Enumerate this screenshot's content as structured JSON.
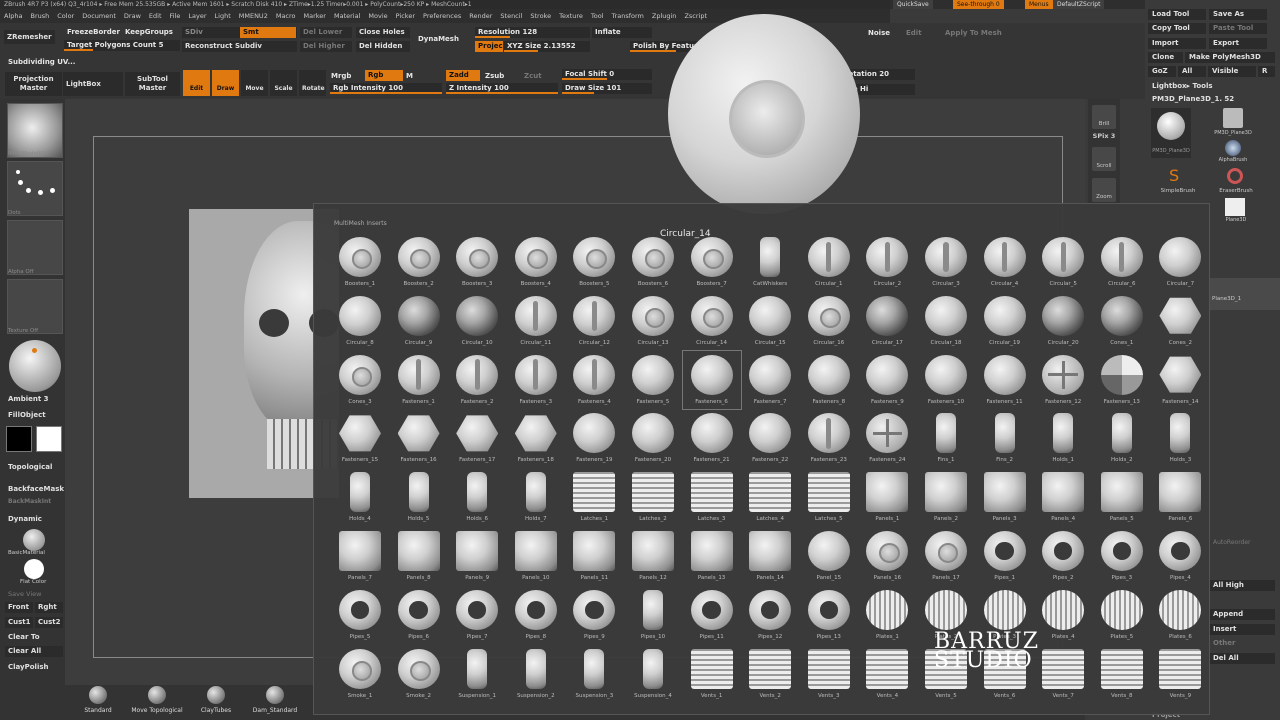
{
  "title_bar": {
    "text": "ZBrush 4R7 P3 (x64)   Q3_4r104   ▸ Free Mem 25.535GB ▸ Active Mem 1601 ▸ Scratch Disk 410 ▸ ZTime▸1.25 Timer▸0.001 ▸ PolyCount▸250 KP ▸ MeshCount▸1"
  },
  "top_right": {
    "quicksave": "QuickSave",
    "seethrough": "See-through 0",
    "menus": "Menus",
    "defaultzscript": "DefaultZScript"
  },
  "menus": [
    "Alpha",
    "Brush",
    "Color",
    "Document",
    "Draw",
    "Edit",
    "File",
    "Layer",
    "Light",
    "MMENU2",
    "Macro",
    "Marker",
    "Material",
    "Movie",
    "Picker",
    "Preferences",
    "Render",
    "Stencil",
    "Stroke",
    "Texture",
    "Tool",
    "Transform",
    "Zplugin",
    "Zscript"
  ],
  "toolbar": {
    "zremesher": "ZRemesher",
    "freezeborder": "FreezeBorder",
    "keepgroups": "KeepGroups",
    "target_polygons": "Target Polygons Count 5",
    "sdiv": "SDiv",
    "smt": "Smt",
    "reconstruct": "Reconstruct Subdiv",
    "del_lower": "Del Lower",
    "del_higher": "Del Higher",
    "close_holes": "Close Holes",
    "del_hidden": "Del Hidden",
    "dynamesh": "DynaMesh",
    "resolution": "Resolution 128",
    "project": "Projec",
    "xyz_size": "XYZ Size 2.13552",
    "inflate": "Inflate",
    "polish": "Polish By Feature",
    "noise": "Noise",
    "edit_noise": "Edit",
    "apply_mesh": "Apply To Mesh",
    "subdividing": "Subdividing UV...",
    "projection_master": "Projection Master",
    "lightbox": "LightBox",
    "subtool_master": "SubTool Master",
    "edit": "Edit",
    "draw": "Draw",
    "move": "Move",
    "scale": "Scale",
    "rotate": "Rotate",
    "mrgb": "Mrgb",
    "rgb": "Rgb",
    "m": "M",
    "zadd": "Zadd",
    "zsub": "Zsub",
    "zcut": "Zcut",
    "rgb_intensity": "Rgb Intensity 100",
    "z_intensity": "Z Intensity 100",
    "focal_shift": "Focal Shift 0",
    "draw_size": "Draw Size 101",
    "rotation": "Rotation 20",
    "uv_hi": "Use Hi"
  },
  "left_shelf": {
    "brush_cap": "IMM_ModelKit",
    "stroke_cap": "Dots",
    "alpha_cap": "Alpha Off",
    "texture_cap": "Texture Off",
    "ambient": "Ambient 3",
    "fillobject": "FillObject",
    "topological": "Topological",
    "backfacemask": "BackfaceMask",
    "backmaskint": "BackMaskInt",
    "dynamic": "Dynamic",
    "material": "BasicMaterial",
    "flat_color": "Flat Color",
    "save_view": "Save View",
    "front": "Front",
    "right": "Rght",
    "cust1": "Cust1",
    "cust2": "Cust2",
    "clear_to": "Clear To",
    "clear_all": "Clear All",
    "claypolish": "ClayPolish"
  },
  "right_shelf": {
    "brill": "Brill",
    "spix": "SPix 3",
    "scroll": "Scroll",
    "zoom": "Zoom"
  },
  "right_panel": {
    "load_tool": "Load Tool",
    "save_as": "Save As",
    "copy_tool": "Copy Tool",
    "paste_tool": "Paste Tool",
    "import": "Import",
    "export": "Export",
    "clone": "Clone",
    "make_polymesh": "Make PolyMesh3D",
    "goz": "GoZ",
    "all": "All",
    "visible": "Visible",
    "r": "R",
    "lightbox_tools": "Lightbox▸ Tools",
    "current_tool": "PM3D_Plane3D_1. 52",
    "tool1": "PM3D_Plane3D",
    "tool2": "PM3D_Plane3D",
    "tool3": "AlphaBrush",
    "tool4": "SimpleBrush",
    "tool5": "EraserBrush",
    "tool6": "Plane3D",
    "all_high": "All High",
    "append": "Append",
    "insert": "Insert",
    "other": "Other",
    "del_all": "Del All",
    "project": "Project",
    "subtool_sel": "Plane3D_1",
    "autoreorder": "AutoReorder"
  },
  "bottom_brushes": [
    "Standard",
    "Move Topological",
    "ClayTubes",
    "Dam_Standard"
  ],
  "popup": {
    "title": "MultiMesh Inserts",
    "hover_label": "Circular_14",
    "items": [
      "Boosters_1",
      "Boosters_2",
      "Boosters_3",
      "Boosters_4",
      "Boosters_5",
      "Boosters_6",
      "Boosters_7",
      "CatWhiskers",
      "Circular_1",
      "Circular_2",
      "Circular_3",
      "Circular_4",
      "Circular_5",
      "Circular_6",
      "Circular_7",
      "Circular_8",
      "Circular_9",
      "Circular_10",
      "Circular_11",
      "Circular_12",
      "Circular_13",
      "Circular_14",
      "Circular_15",
      "Circular_16",
      "Circular_17",
      "Circular_18",
      "Circular_19",
      "Circular_20",
      "Cones_1",
      "Cones_2",
      "Cones_3",
      "Fasteners_1",
      "Fasteners_2",
      "Fasteners_3",
      "Fasteners_4",
      "Fasteners_5",
      "Fasteners_6",
      "Fasteners_7",
      "Fasteners_8",
      "Fasteners_9",
      "Fasteners_10",
      "Fasteners_11",
      "Fasteners_12",
      "Fasteners_13",
      "Fasteners_14",
      "Fasteners_15",
      "Fasteners_16",
      "Fasteners_17",
      "Fasteners_18",
      "Fasteners_19",
      "Fasteners_20",
      "Fasteners_21",
      "Fasteners_22",
      "Fasteners_23",
      "Fasteners_24",
      "Fins_1",
      "Fins_2",
      "Holds_1",
      "Holds_2",
      "Holds_3",
      "Holds_4",
      "Holds_5",
      "Holds_6",
      "Holds_7",
      "Latches_1",
      "Latches_2",
      "Latches_3",
      "Latches_4",
      "Latches_5",
      "Panels_1",
      "Panels_2",
      "Panels_3",
      "Panels_4",
      "Panels_5",
      "Panels_6",
      "Panels_7",
      "Panels_8",
      "Panels_9",
      "Panels_10",
      "Panels_11",
      "Panels_12",
      "Panels_13",
      "Panels_14",
      "Panel_15",
      "Panels_16",
      "Panels_17",
      "Pipes_1",
      "Pipes_2",
      "Pipes_3",
      "Pipes_4",
      "Pipes_5",
      "Pipes_6",
      "Pipes_7",
      "Pipes_8",
      "Pipes_9",
      "Pipes_10",
      "Pipes_11",
      "Pipes_12",
      "Pipes_13",
      "Plates_1",
      "Plates_2",
      "Plates_3",
      "Plates_4",
      "Plates_5",
      "Plates_6",
      "Smoke_1",
      "Smoke_2",
      "Suspension_1",
      "Suspension_2",
      "Suspension_3",
      "Suspension_4",
      "Vents_1",
      "Vents_2",
      "Vents_3",
      "Vents_4",
      "Vents_5",
      "Vents_6",
      "Vents_7",
      "Vents_8",
      "Vents_9"
    ],
    "selected": "Fasteners_6"
  },
  "logo": {
    "line1": "BARRUZ",
    "line2": "STUDIO"
  }
}
